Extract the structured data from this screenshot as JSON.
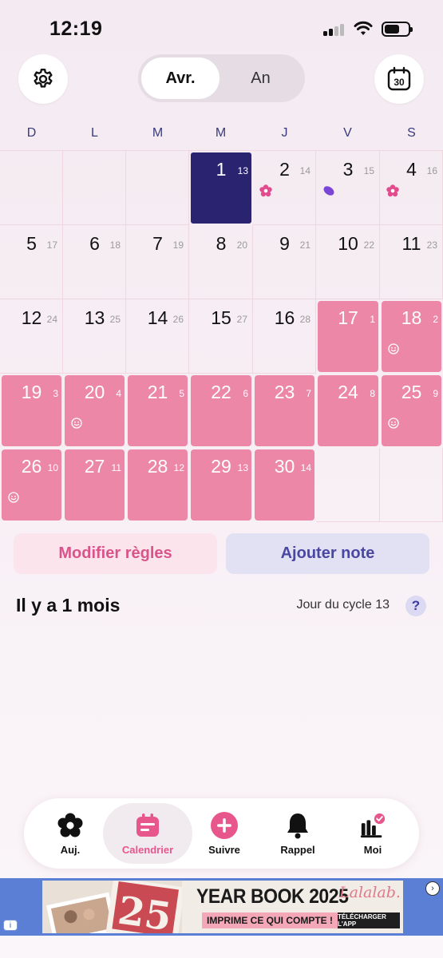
{
  "status_bar": {
    "time": "12:19"
  },
  "header": {
    "segments": [
      "Avr.",
      "An"
    ],
    "selected_segment": "Avr.",
    "settings_icon": "gear-icon",
    "today_icon": "calendar-30-icon",
    "today_label": "30"
  },
  "weekdays": [
    "D",
    "L",
    "M",
    "M",
    "J",
    "V",
    "S"
  ],
  "calendar": {
    "leading_blank_days": 3,
    "days": [
      {
        "day": "1",
        "cycle": "13",
        "state": "today"
      },
      {
        "day": "2",
        "cycle": "14",
        "marker": "flower"
      },
      {
        "day": "3",
        "cycle": "15",
        "marker": "drop"
      },
      {
        "day": "4",
        "cycle": "16",
        "marker": "flower"
      },
      {
        "day": "5",
        "cycle": "17"
      },
      {
        "day": "6",
        "cycle": "18"
      },
      {
        "day": "7",
        "cycle": "19"
      },
      {
        "day": "8",
        "cycle": "20"
      },
      {
        "day": "9",
        "cycle": "21"
      },
      {
        "day": "10",
        "cycle": "22"
      },
      {
        "day": "11",
        "cycle": "23"
      },
      {
        "day": "12",
        "cycle": "24"
      },
      {
        "day": "13",
        "cycle": "25"
      },
      {
        "day": "14",
        "cycle": "26"
      },
      {
        "day": "15",
        "cycle": "27"
      },
      {
        "day": "16",
        "cycle": "28"
      },
      {
        "day": "17",
        "cycle": "1",
        "state": "period"
      },
      {
        "day": "18",
        "cycle": "2",
        "state": "period",
        "mood": true
      },
      {
        "day": "19",
        "cycle": "3",
        "state": "period"
      },
      {
        "day": "20",
        "cycle": "4",
        "state": "period",
        "mood": true
      },
      {
        "day": "21",
        "cycle": "5",
        "state": "period"
      },
      {
        "day": "22",
        "cycle": "6",
        "state": "period"
      },
      {
        "day": "23",
        "cycle": "7",
        "state": "period"
      },
      {
        "day": "24",
        "cycle": "8",
        "state": "period"
      },
      {
        "day": "25",
        "cycle": "9",
        "state": "period",
        "mood": true
      },
      {
        "day": "26",
        "cycle": "10",
        "state": "period",
        "mood": true
      },
      {
        "day": "27",
        "cycle": "11",
        "state": "period"
      },
      {
        "day": "28",
        "cycle": "12",
        "state": "period"
      },
      {
        "day": "29",
        "cycle": "13",
        "state": "period"
      },
      {
        "day": "30",
        "cycle": "14",
        "state": "period"
      }
    ]
  },
  "actions": {
    "modify": "Modifier règles",
    "add_note": "Ajouter note"
  },
  "summary": {
    "since": "Il y a 1 mois",
    "cycle_day": "Jour du cycle 13",
    "help": "?"
  },
  "nav": {
    "items": [
      {
        "label": "Auj.",
        "icon": "flower-icon"
      },
      {
        "label": "Calendrier",
        "icon": "calendar-icon",
        "active": true
      },
      {
        "label": "Suivre",
        "icon": "plus-circle-icon"
      },
      {
        "label": "Rappel",
        "icon": "bell-icon"
      },
      {
        "label": "Moi",
        "icon": "chart-check-icon"
      }
    ]
  },
  "ad": {
    "title": "YEAR BOOK 2025",
    "tagline": "IMPRIME CE QUI COMPTE !",
    "brand": "Lalalab.",
    "cta": "TÉLÉCHARGER L'APP",
    "photo_text": "25",
    "info": "i"
  },
  "colors": {
    "period": "#ec87a8",
    "today": "#2a2470",
    "accent_pink": "#e8578c",
    "accent_purple": "#4a47a3"
  }
}
